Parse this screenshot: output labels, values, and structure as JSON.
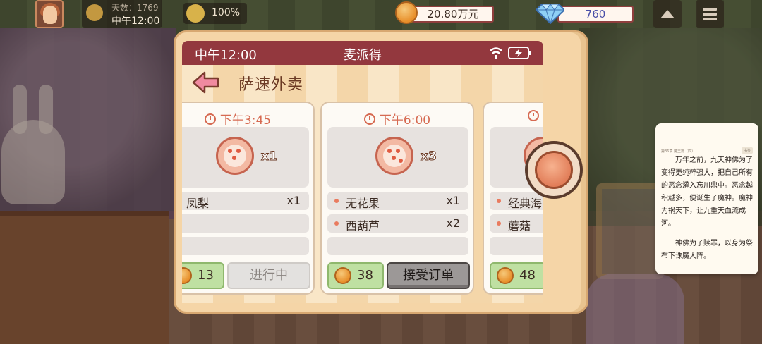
{
  "hud": {
    "day_label": "天数：1769",
    "time": "中午12:00",
    "mood": "100%",
    "coins": "20.80万元",
    "gems": "760"
  },
  "phone": {
    "status_time": "中午12:00",
    "app_name": "麦派得",
    "page_title": "萨速外卖"
  },
  "orders": [
    {
      "time": "下午3:45",
      "food_qty": "x1",
      "items": [
        {
          "name": "凤梨",
          "qty": "x1"
        }
      ],
      "reward": "13",
      "action": "进行中"
    },
    {
      "time": "下午6:00",
      "food_qty": "x3",
      "items": [
        {
          "name": "无花果",
          "qty": "x1"
        },
        {
          "name": "西葫芦",
          "qty": "x2"
        }
      ],
      "reward": "38",
      "action": "接受订单"
    },
    {
      "time": "",
      "food_qty": "",
      "items": [
        {
          "name": "经典海",
          "qty": ""
        },
        {
          "name": "蘑菇",
          "qty": ""
        }
      ],
      "reward": "48",
      "action": ""
    }
  ],
  "reader": {
    "top_left": "第36章 魔王篇（四）",
    "top_right": "书签",
    "paragraph1": "万年之前，九天神佛为了变得更纯粹强大，把自己所有的恶念灌入忘川鼎中。恶念越积越多，便诞生了魔神。魔神为祸天下，让九重天血流成河。",
    "paragraph2": "神佛为了赎罪，以身为祭布下诛魔大阵。"
  },
  "colors": {
    "status_bar": "#93383e",
    "accent_orange": "#d66a52",
    "reward_green": "#bfe0a2"
  }
}
